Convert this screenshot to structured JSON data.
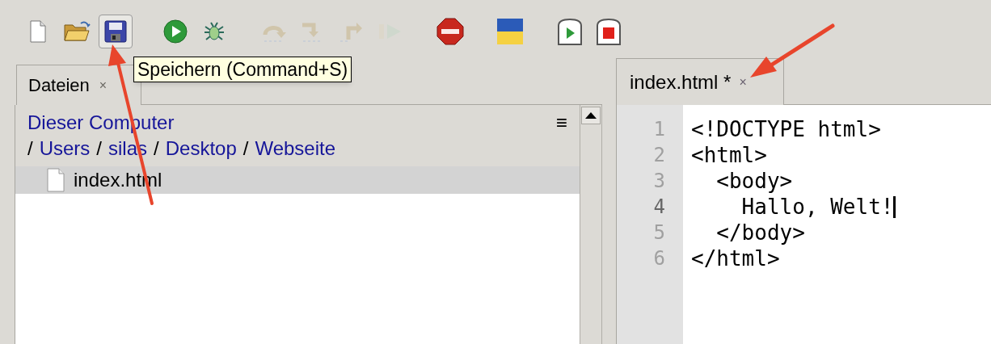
{
  "toolbar": [
    {
      "kind": "new",
      "disabled": false,
      "hovered": false
    },
    {
      "kind": "open",
      "disabled": false,
      "hovered": false
    },
    {
      "kind": "save",
      "disabled": false,
      "hovered": true
    },
    {
      "kind": "run",
      "disabled": false,
      "hovered": false
    },
    {
      "kind": "debug",
      "disabled": false,
      "hovered": false
    },
    {
      "kind": "step_over",
      "disabled": true,
      "hovered": false
    },
    {
      "kind": "step_into",
      "disabled": true,
      "hovered": false
    },
    {
      "kind": "step_out",
      "disabled": true,
      "hovered": false
    },
    {
      "kind": "resume",
      "disabled": true,
      "hovered": false
    },
    {
      "kind": "stop",
      "disabled": false,
      "hovered": false
    },
    {
      "kind": "flag",
      "disabled": false,
      "hovered": false
    },
    {
      "kind": "run_current",
      "disabled": false,
      "hovered": false
    },
    {
      "kind": "stop_square",
      "disabled": false,
      "hovered": false
    }
  ],
  "tooltip": "Speichern (Command+S)",
  "files_panel": {
    "tab": {
      "label": "Dateien",
      "close": "×"
    },
    "location": "Dieser Computer",
    "menu": "≡",
    "path": [
      {
        "separator": "/",
        "label": "Users"
      },
      {
        "separator": "/",
        "label": "silas"
      },
      {
        "separator": "/",
        "label": "Desktop"
      },
      {
        "separator": "/",
        "label": "Webseite"
      }
    ],
    "files": [
      {
        "name": "index.html",
        "selected": true
      }
    ]
  },
  "editor": {
    "tab": {
      "label": "index.html *",
      "close": "×"
    },
    "lines": [
      {
        "number": "1",
        "text": "<!DOCTYPE html>",
        "current": false
      },
      {
        "number": "2",
        "text": "<html>",
        "current": false
      },
      {
        "number": "3",
        "text": "  <body>",
        "current": false
      },
      {
        "number": "4",
        "text": "    Hallo, Welt!",
        "current": true
      },
      {
        "number": "5",
        "text": "  </body>",
        "current": false
      },
      {
        "number": "6",
        "text": "</html>",
        "current": false
      }
    ]
  }
}
